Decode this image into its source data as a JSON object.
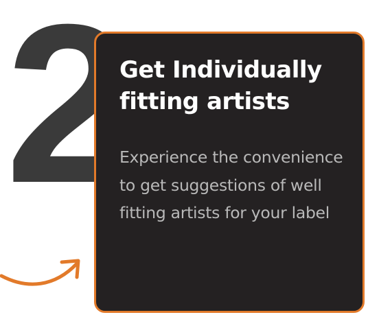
{
  "step": {
    "number": "2"
  },
  "card": {
    "title": "Get Individually fitting artists",
    "description": "Experience the convenience to get suggestions of well fitting artists for your label"
  },
  "colors": {
    "accent": "#e27a2a",
    "card_background": "#242122",
    "number": "#3a3a3a",
    "title": "#ffffff",
    "description": "#b9b9b9"
  },
  "icons": {
    "arrow": "curved-arrow-icon"
  }
}
